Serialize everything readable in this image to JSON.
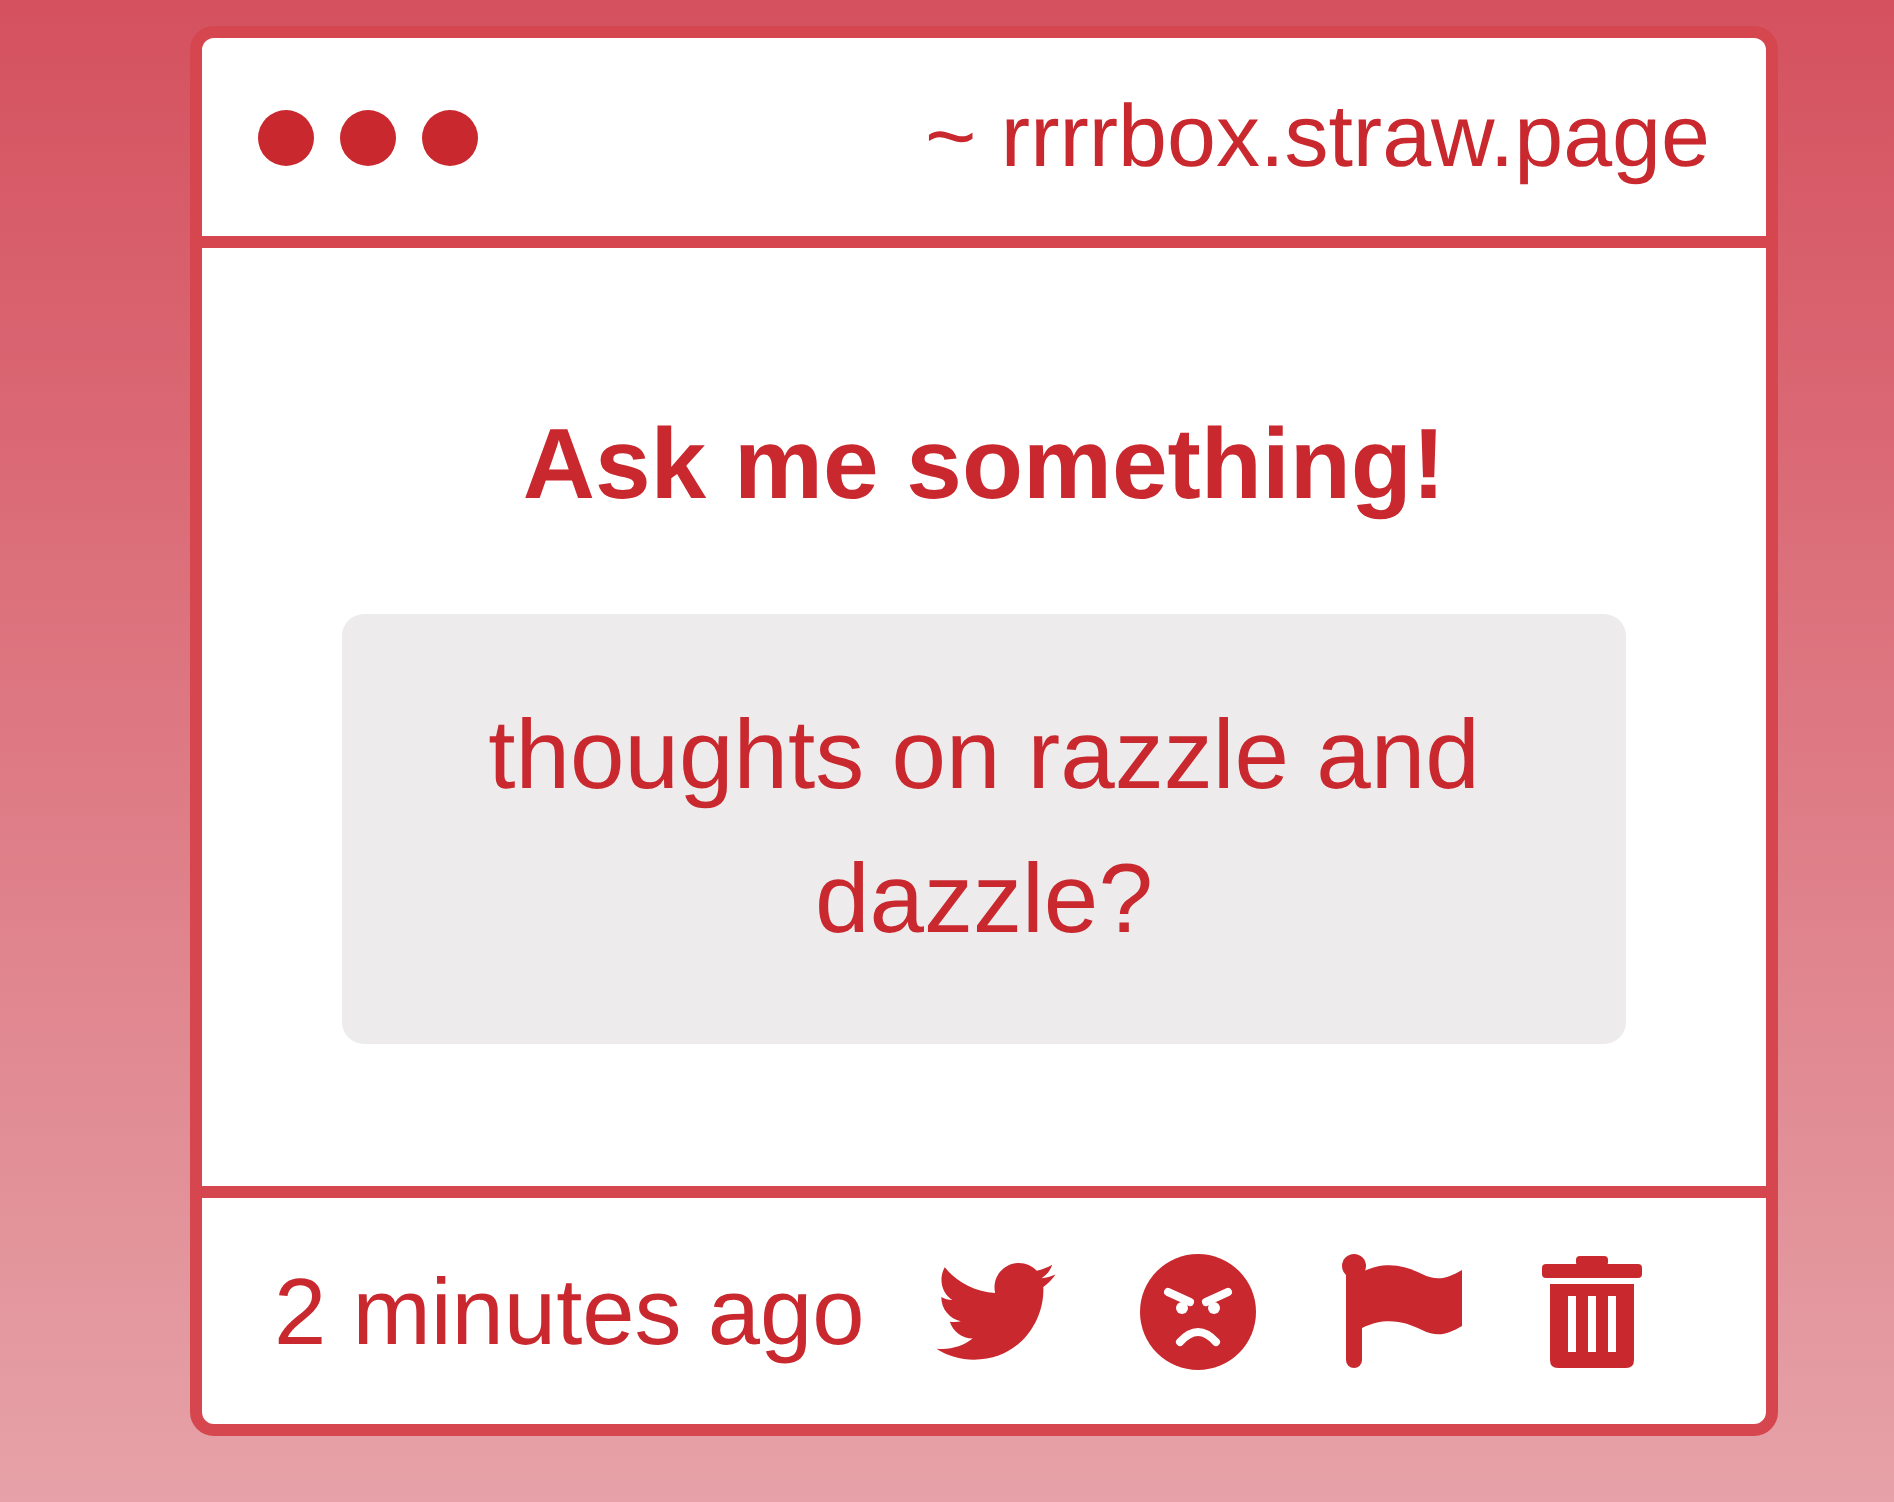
{
  "window": {
    "url": "~ rrrrbox.straw.page"
  },
  "prompt": {
    "title": "Ask me something!"
  },
  "question": {
    "text": "thoughts on razzle and dazzle?"
  },
  "footer": {
    "time": "2 minutes ago"
  }
}
